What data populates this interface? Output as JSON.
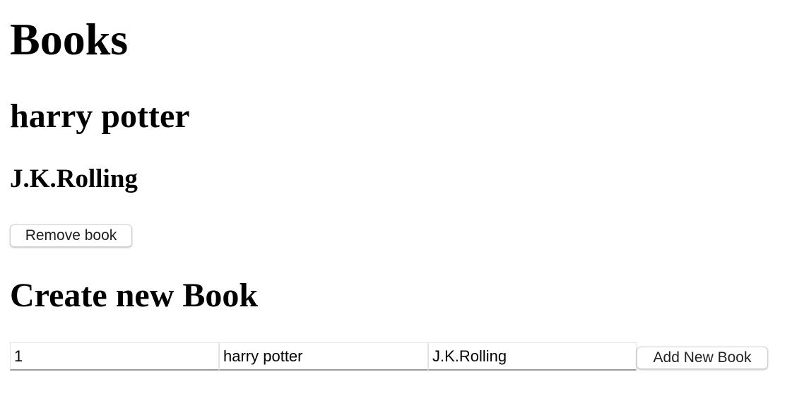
{
  "page": {
    "heading": "Books"
  },
  "book": {
    "title": "harry potter",
    "author": "J.K.Rolling",
    "remove_label": "Remove book"
  },
  "create": {
    "heading": "Create new Book",
    "id_value": "1",
    "title_value": "harry potter",
    "author_value": "J.K.Rolling",
    "add_label": "Add New Book"
  }
}
